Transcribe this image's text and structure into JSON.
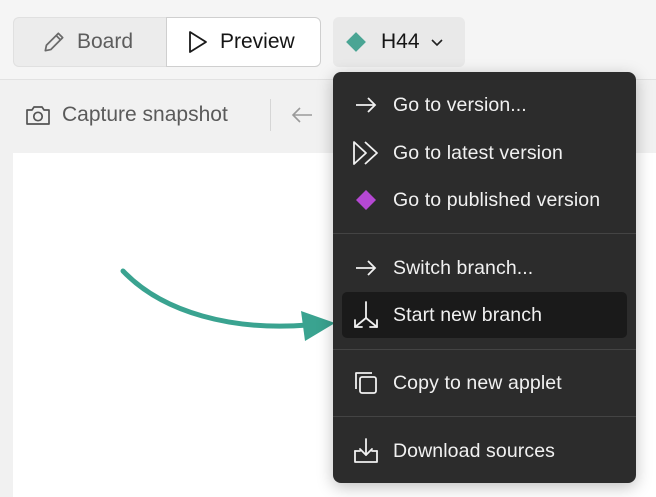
{
  "topbar": {
    "board_label": "Board",
    "preview_label": "Preview",
    "version_label": "H44",
    "version_color": "#4aa594"
  },
  "toolbar": {
    "capture_label": "Capture snapshot"
  },
  "menu": {
    "items": [
      {
        "label": "Go to version...",
        "icon": "arrow-right-icon"
      },
      {
        "label": "Go to latest version",
        "icon": "fast-forward-icon"
      },
      {
        "label": "Go to published version",
        "icon": "published-diamond-icon",
        "icon_color": "#b548d3"
      },
      {
        "label": "Switch branch...",
        "icon": "arrow-right-icon"
      },
      {
        "label": "Start new branch",
        "icon": "branch-fork-icon",
        "highlighted": true
      },
      {
        "label": "Copy to new applet",
        "icon": "copy-icon"
      },
      {
        "label": "Download sources",
        "icon": "download-icon"
      }
    ]
  },
  "annotation": {
    "arrow_color": "#3aa390",
    "arrow_icon": "curved-arrow-icon"
  }
}
